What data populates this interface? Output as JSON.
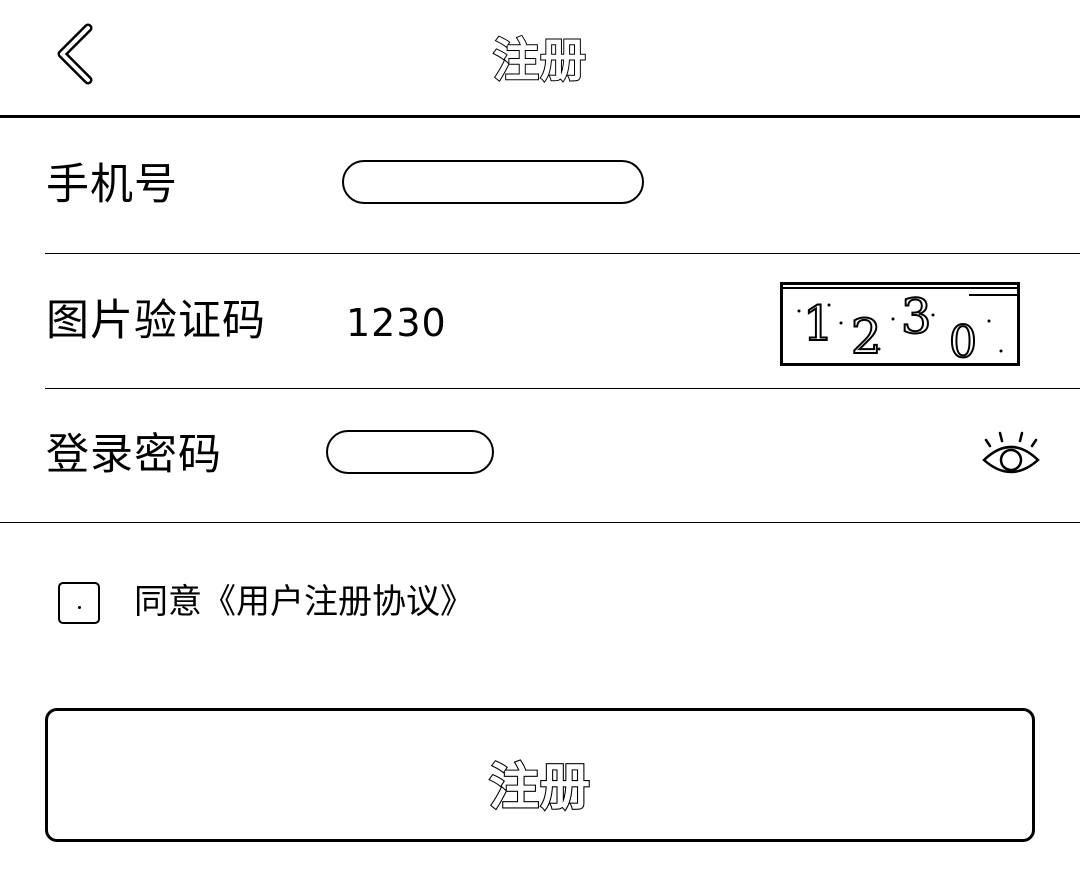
{
  "header": {
    "back_icon": "chevron-left-icon",
    "title": "注册"
  },
  "form": {
    "phone": {
      "label": "手机号",
      "value": "",
      "placeholder": ""
    },
    "captcha": {
      "label": "图片验证码",
      "value": "1230",
      "image_text": "1230",
      "image_icon": "captcha-image"
    },
    "password": {
      "label": "登录密码",
      "value": "",
      "placeholder": "",
      "toggle_icon": "eye-icon"
    }
  },
  "agreement": {
    "checked": false,
    "prefix": "同意",
    "link": "《用户注册协议》"
  },
  "submit": {
    "label": "注册"
  }
}
